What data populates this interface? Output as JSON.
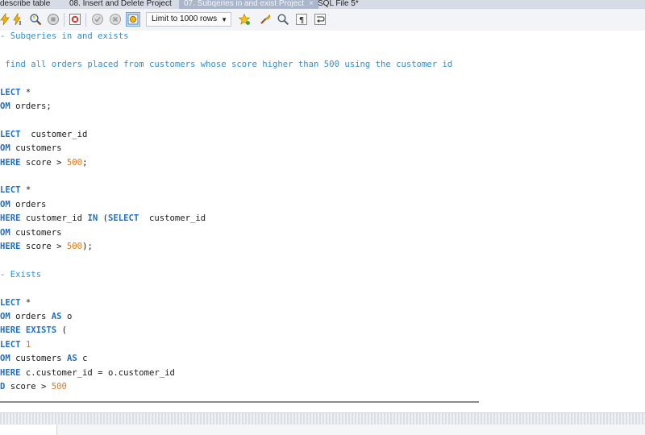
{
  "tabs": [
    {
      "label": "describe table"
    },
    {
      "label": "08. Insert and Delete Project"
    },
    {
      "label": "07. Subqeries in and exist Project",
      "close": "×"
    },
    {
      "label": "SQL File 5*"
    }
  ],
  "toolbar": {
    "limit_label": "Limit to 1000 rows",
    "buttons": [
      "lightning-icon",
      "lightning-cursor-icon",
      "magnifier-explain-icon",
      "stop-icon",
      "toggle-stop-on-error-icon",
      "commit-icon",
      "rollback-icon",
      "autocommit-icon",
      "bookmark-star-icon",
      "beautify-brush-icon",
      "find-icon",
      "invisible-chars-icon",
      "wrap-lines-icon"
    ]
  },
  "colors": {
    "keyword": "#1f6fc5",
    "comment": "#2f8fd6",
    "number": "#e0781a"
  },
  "code": [
    {
      "tokens": [
        {
          "t": "- Subqeries in and exists",
          "c": "cm"
        }
      ]
    },
    {
      "tokens": []
    },
    {
      "tokens": [
        {
          "t": " find all orders placed from customers whose score higher than 500 using the customer id",
          "c": "cm"
        }
      ]
    },
    {
      "tokens": []
    },
    {
      "tokens": [
        {
          "t": "LECT",
          "c": "kw"
        },
        {
          "t": " *",
          "c": "plain"
        }
      ]
    },
    {
      "tokens": [
        {
          "t": "OM",
          "c": "kw"
        },
        {
          "t": " orders;",
          "c": "plain"
        }
      ]
    },
    {
      "tokens": []
    },
    {
      "tokens": [
        {
          "t": "LECT",
          "c": "kw"
        },
        {
          "t": "  customer_id",
          "c": "plain"
        }
      ]
    },
    {
      "tokens": [
        {
          "t": "OM",
          "c": "kw"
        },
        {
          "t": " customers",
          "c": "plain"
        }
      ]
    },
    {
      "tokens": [
        {
          "t": "HERE",
          "c": "kw"
        },
        {
          "t": " score > ",
          "c": "plain"
        },
        {
          "t": "500",
          "c": "num"
        },
        {
          "t": ";",
          "c": "plain"
        }
      ]
    },
    {
      "tokens": []
    },
    {
      "tokens": [
        {
          "t": "LECT",
          "c": "kw"
        },
        {
          "t": " *",
          "c": "plain"
        }
      ]
    },
    {
      "tokens": [
        {
          "t": "OM",
          "c": "kw"
        },
        {
          "t": " orders",
          "c": "plain"
        }
      ]
    },
    {
      "tokens": [
        {
          "t": "HERE",
          "c": "kw"
        },
        {
          "t": " customer_id ",
          "c": "plain"
        },
        {
          "t": "IN",
          "c": "kw"
        },
        {
          "t": " (",
          "c": "plain"
        },
        {
          "t": "SELECT",
          "c": "kw"
        },
        {
          "t": "  customer_id",
          "c": "plain"
        }
      ]
    },
    {
      "tokens": [
        {
          "t": "OM",
          "c": "kw"
        },
        {
          "t": " customers",
          "c": "plain"
        }
      ]
    },
    {
      "tokens": [
        {
          "t": "HERE",
          "c": "kw"
        },
        {
          "t": " score > ",
          "c": "plain"
        },
        {
          "t": "500",
          "c": "num"
        },
        {
          "t": ");",
          "c": "plain"
        }
      ]
    },
    {
      "tokens": []
    },
    {
      "tokens": [
        {
          "t": "- Exists",
          "c": "cm"
        }
      ]
    },
    {
      "tokens": []
    },
    {
      "tokens": [
        {
          "t": "LECT",
          "c": "kw"
        },
        {
          "t": " *",
          "c": "plain"
        }
      ]
    },
    {
      "tokens": [
        {
          "t": "OM",
          "c": "kw"
        },
        {
          "t": " orders ",
          "c": "plain"
        },
        {
          "t": "AS",
          "c": "kw"
        },
        {
          "t": " o",
          "c": "plain"
        }
      ]
    },
    {
      "tokens": [
        {
          "t": "HERE",
          "c": "kw"
        },
        {
          "t": " ",
          "c": "plain"
        },
        {
          "t": "EXISTS",
          "c": "kw"
        },
        {
          "t": " (",
          "c": "plain"
        }
      ]
    },
    {
      "tokens": [
        {
          "t": "LECT",
          "c": "kw"
        },
        {
          "t": " ",
          "c": "plain"
        },
        {
          "t": "1",
          "c": "num"
        }
      ]
    },
    {
      "tokens": [
        {
          "t": "OM",
          "c": "kw"
        },
        {
          "t": " customers ",
          "c": "plain"
        },
        {
          "t": "AS",
          "c": "kw"
        },
        {
          "t": " c",
          "c": "plain"
        }
      ]
    },
    {
      "tokens": [
        {
          "t": "HERE",
          "c": "kw"
        },
        {
          "t": " c.customer_id = o.customer_id",
          "c": "plain"
        }
      ]
    },
    {
      "tokens": [
        {
          "t": "D",
          "c": "kw"
        },
        {
          "t": " score > ",
          "c": "plain"
        },
        {
          "t": "500",
          "c": "num"
        }
      ]
    }
  ]
}
